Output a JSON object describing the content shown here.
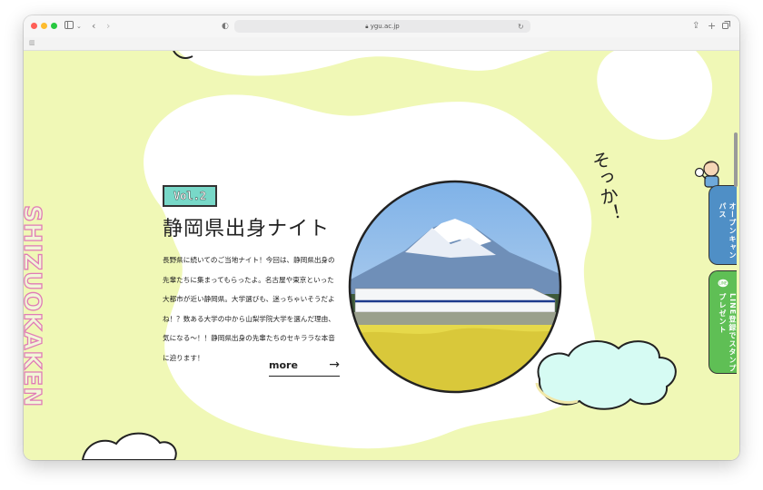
{
  "browser": {
    "url": "ygu.ac.jp",
    "colors": {
      "close": "#ff5f57",
      "minimize": "#febc2e",
      "maximize": "#28c840"
    }
  },
  "page": {
    "side_vertical_text": "SHIZUOKAKEN",
    "vol_badge": "Vol.2",
    "title": "静岡県出身ナイト",
    "body": "長野県に続いてのご当地ナイト！今回は、静岡県出身の先輩たちに集まってもらったよ。名古屋や東京といった大都市が近い静岡県。大学選びも、迷っちゃいそうだよね！？数ある大学の中から山梨学院大学を選んだ理由、気になる〜！！静岡県出身の先輩たちのセキララな本音に迫ります！",
    "more_label": "more",
    "handwriting": "そっか！",
    "colors": {
      "background": "#f0f8b6",
      "badge": "#78d8c8",
      "vertical_outline": "#e07bb6"
    }
  },
  "side_tabs": [
    {
      "label": "オープンキャンパス",
      "color": "#4f8fc6"
    },
    {
      "label": "LINE登録でスタンププレゼント",
      "color": "#5fbf55"
    }
  ],
  "icons": [
    "sidebar-icon",
    "back-icon",
    "forward-icon",
    "shield-icon",
    "lock-icon",
    "refresh-icon",
    "share-icon",
    "new-tab-icon",
    "tabs-icon",
    "line-icon",
    "magnifier-icon"
  ]
}
